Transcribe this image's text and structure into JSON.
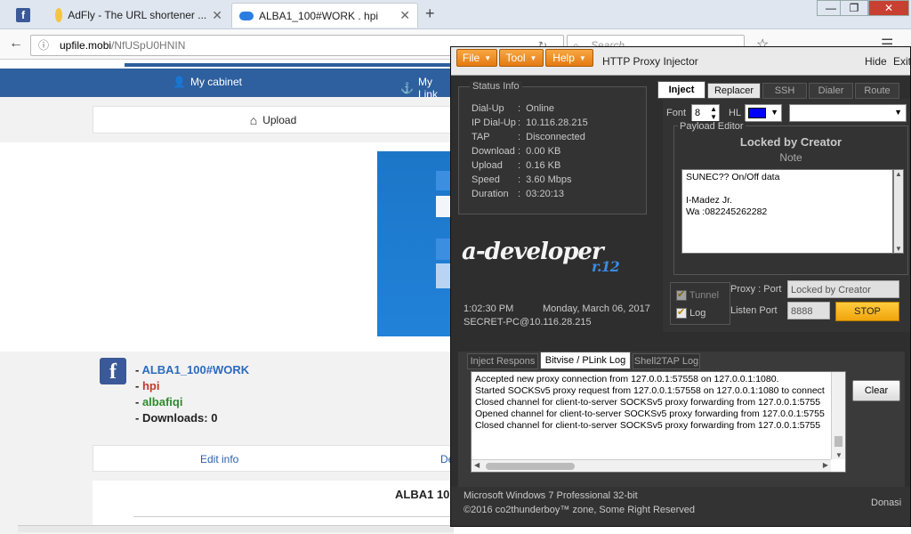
{
  "browser": {
    "tabs": [
      {
        "title": "",
        "icon": "facebook-icon"
      },
      {
        "title": "AdFly - The URL shortener ...",
        "icon": "adfly-icon"
      },
      {
        "title": "ALBA1_100#WORK . hpi",
        "icon": "cloud-icon"
      }
    ],
    "url_host": "upfile.mobi",
    "url_path": "/NfUSpU0HNIN",
    "search_placeholder": "Search"
  },
  "site": {
    "menu": [
      "My cabinet",
      "My Link"
    ],
    "upload_label": "Upload",
    "file_info": {
      "name": "ALBA1_100#WORK",
      "ext": "hpi",
      "owner": "albafiqi",
      "downloads": "Downloads: 0"
    },
    "edit_tabs": [
      "Edit info",
      "De"
    ],
    "title_partial": "ALBA1 10"
  },
  "injector": {
    "menu": [
      "File",
      "Tool",
      "Help"
    ],
    "title": "HTTP Proxy Injector",
    "hide_label": "Hide",
    "exit_label": "Exit",
    "status": {
      "title": "Status Info",
      "rows": [
        {
          "k": "Dial-Up",
          "v": "Online"
        },
        {
          "k": "IP Dial-Up",
          "v": "10.116.28.215"
        },
        {
          "k": "TAP",
          "v": "Disconnected"
        },
        {
          "k": "Download",
          "v": "0.00 KB"
        },
        {
          "k": "Upload",
          "v": "0.16 KB"
        },
        {
          "k": "Speed",
          "v": "3.60 Mbps"
        },
        {
          "k": "Duration",
          "v": "03:20:13"
        }
      ]
    },
    "logo_text": "a-developer",
    "logo_sub": "r.12",
    "clock": "1:02:30 PM",
    "date": "Monday, March 06, 2017",
    "host": "SECRET-PC@10.116.28.215",
    "tabs": [
      "Inject",
      "Replacer",
      "SSH",
      "Dialer",
      "Route"
    ],
    "font_label": "Font",
    "font_size": "8",
    "hl_label": "HL",
    "payload_editor_label": "Payload Editor",
    "locked_label": "Locked by Creator",
    "note_label": "Note",
    "note_lines": [
      "SUNEC?? On/Off data",
      "",
      "I-Madez Jr.",
      "Wa :082245262282"
    ],
    "tunnel_label": "Tunnel",
    "log_label": "Log",
    "proxy_port_label": "Proxy : Port",
    "proxy_port_value": "Locked by Creator",
    "listen_port_label": "Listen Port",
    "listen_port_value": "8888",
    "stop_label": "STOP",
    "log_tabs": [
      "Inject Respons",
      "Bitvise / PLink Log",
      "Shell2TAP Log"
    ],
    "log_lines": [
      "Accepted new proxy connection from 127.0.0.1:57558 on 127.0.0.1:1080.",
      "Started SOCKSv5 proxy request from 127.0.0.1:57558 on 127.0.0.1:1080 to connect",
      "Closed channel for client-to-server SOCKSv5 proxy forwarding from 127.0.0.1:5755",
      "Opened channel for client-to-server SOCKSv5 proxy forwarding from 127.0.0.1:5755",
      "Closed channel for client-to-server SOCKSv5 proxy forwarding from 127.0.0.1:5755"
    ],
    "clear_label": "Clear",
    "footer_os": "Microsoft Windows 7 Professional  32-bit",
    "footer_copy": "©2016 co2thunderboy™ zone, Some Right Reserved",
    "donate_label": "Donasi"
  },
  "colors": {
    "site_blue": "#2e5f9e",
    "accent_orange": "#e57a12",
    "stop_yellow": "#f0a40c",
    "hl_color": "#0000ff"
  }
}
